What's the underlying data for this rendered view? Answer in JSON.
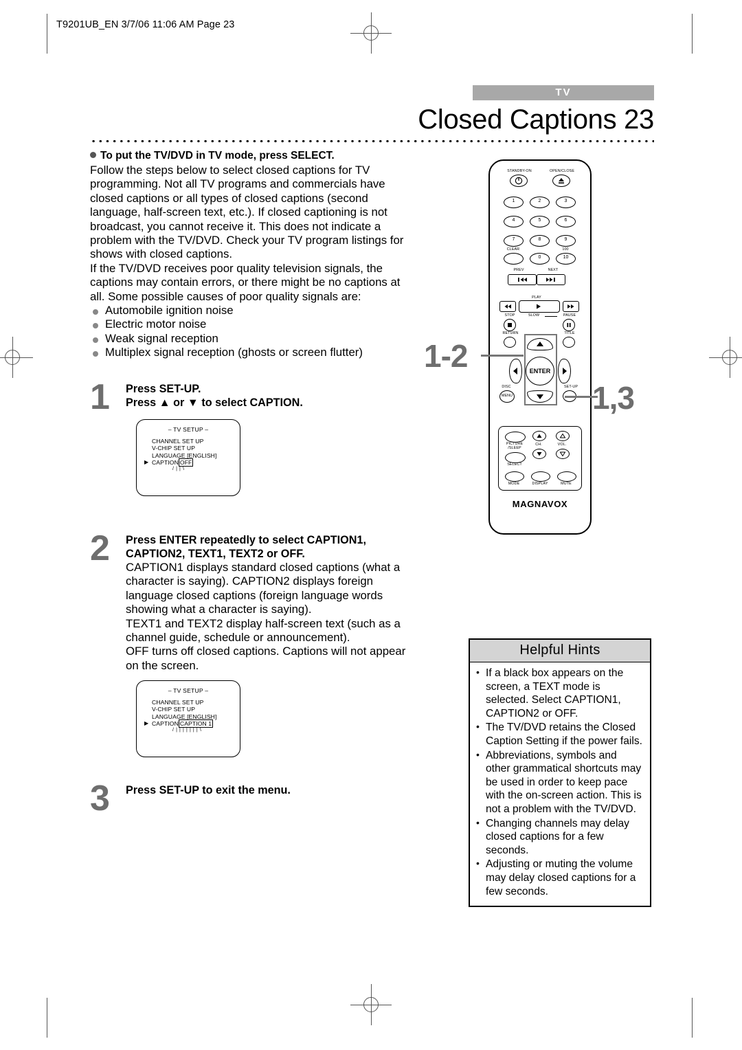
{
  "runhead": "T9201UB_EN 3/7/06 11:06 AM Page 23",
  "header": {
    "banner": "TV",
    "title": "Closed Captions  23"
  },
  "intro": {
    "lead": "To put the TV/DVD in TV mode, press SELECT.",
    "paragraph1": "Follow the steps below to select closed captions for TV programming. Not all TV programs and commercials have closed captions or all types of closed captions (second language, half-screen text, etc.). If closed captioning is not broadcast, you cannot receive it. This does not indicate a problem with the TV/DVD. Check your TV program listings for shows with closed captions.",
    "paragraph2": "If the TV/DVD receives poor quality television signals, the captions may contain errors, or there might be no captions at all. Some possible causes of poor quality signals are:",
    "causes": [
      "Automobile ignition noise",
      "Electric motor noise",
      "Weak signal reception",
      "Multiplex signal reception (ghosts or screen flutter)"
    ]
  },
  "steps": [
    {
      "number": "1",
      "head_line1": "Press SET-UP.",
      "head_line2": "Press ▲ or ▼ to select CAPTION."
    },
    {
      "number": "2",
      "head_line1": "Press ENTER repeatedly to select CAPTION1,",
      "head_line2": "CAPTION2, TEXT1, TEXT2 or OFF.",
      "body1": "CAPTION1 displays standard closed captions (what a character is saying). CAPTION2 displays foreign language closed captions (foreign language words showing what a character is saying).",
      "body2": "TEXT1 and TEXT2 display half-screen text (such as a channel guide, schedule or announcement).",
      "body3": "OFF turns off closed captions. Captions will not appear on the screen."
    },
    {
      "number": "3",
      "head_line1": "Press SET-UP to exit the menu."
    }
  ],
  "osd1": {
    "title": "– TV SETUP –",
    "rows": [
      "CHANNEL SET UP",
      "V-CHIP SET UP"
    ],
    "language_label": "LANGUAGE",
    "language_value": "[ENGLISH]",
    "caption_label": "CAPTION",
    "caption_value": "OFF",
    "caret": "▶"
  },
  "osd2": {
    "title": "– TV SETUP –",
    "rows": [
      "CHANNEL SET UP",
      "V-CHIP SET UP"
    ],
    "language_label": "LANGUAGE",
    "language_value": "[ENGLISH]",
    "caption_label": "CAPTION",
    "caption_value": "CAPTION 1",
    "caret": "▶"
  },
  "remote": {
    "brand": "MAGNAVOX",
    "standby_label": "STANDBY-ON",
    "open_close_label": "OPEN/CLOSE",
    "numbers": [
      "1",
      "2",
      "3",
      "4",
      "5",
      "6",
      "7",
      "8",
      "9"
    ],
    "clear_label": "CLEAR",
    "zero_label": "0",
    "hundred_label": "100",
    "ten_label": "10",
    "prev_label": "PREV",
    "next_label": "NEXT",
    "play_label": "PLAY",
    "stop_label": "STOP",
    "slow_label": "SLOW",
    "pause_label": "PAUSE",
    "return_label": "RETURN",
    "title_label": "TITLE",
    "enter_label": "ENTER",
    "disc_label": "DISC",
    "menu_label": "MENU",
    "setup_label": "SET-UP",
    "picture_label": "PICTURE",
    "sleep_label": "/SLEEP",
    "select_label": "SELECT",
    "ch_label": "CH.",
    "vol_label": "VOL.",
    "mode_label": "MODE",
    "display_label": "DISPLAY",
    "mute_label": "MUTE"
  },
  "callouts": {
    "nav": "1-2",
    "setup": "1,3"
  },
  "hints": {
    "heading": "Helpful Hints",
    "items": [
      "If a black box appears on the screen, a TEXT mode is selected. Select CAPTION1, CAPTION2 or OFF.",
      "The TV/DVD retains the Closed Caption Setting if the power fails.",
      "Abbreviations, symbols and other grammatical shortcuts may be used in order to keep pace with the on-screen action. This is not a problem with the TV/DVD.",
      "Changing channels may delay closed captions for a few seconds.",
      "Adjusting or muting the volume may delay closed captions for a few seconds."
    ]
  },
  "colors": {
    "banner_gray": "#a8a8a8",
    "step_number_gray": "#6e6e6e",
    "hints_header_gray": "#d4d4d4"
  }
}
